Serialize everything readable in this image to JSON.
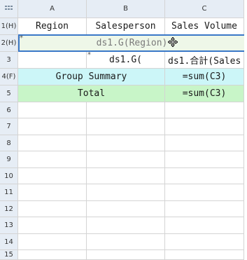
{
  "corner_icon": "select-all-icon",
  "columns": [
    "A",
    "B",
    "C"
  ],
  "rows": [
    {
      "label": "1(H)"
    },
    {
      "label": "2(H)"
    },
    {
      "label": "3"
    },
    {
      "label": "4(F)"
    },
    {
      "label": "5"
    },
    {
      "label": "6"
    },
    {
      "label": "7"
    },
    {
      "label": "8"
    },
    {
      "label": "9"
    },
    {
      "label": "10"
    },
    {
      "label": "11"
    },
    {
      "label": "12"
    },
    {
      "label": "13"
    },
    {
      "label": "14"
    },
    {
      "label": "15"
    }
  ],
  "cells": {
    "r1": {
      "a": "Region",
      "b": "Salesperson",
      "c": "Sales Volume"
    },
    "r2": {
      "merged": "ds1.G(Region)"
    },
    "r3": {
      "a": "",
      "b": "ds1.G(",
      "c": "ds1.合計(Sales"
    },
    "r4": {
      "ab": "Group Summary",
      "c": "=sum(C3)"
    },
    "r5": {
      "ab": "Total",
      "c": "=sum(C3)"
    }
  },
  "colors": {
    "header_bg": "#e6edf5",
    "group_row": "#ccf6f8",
    "total_row": "#c8f5c8",
    "selection_border": "#3a78c8",
    "grid": "#d4d4d4"
  }
}
